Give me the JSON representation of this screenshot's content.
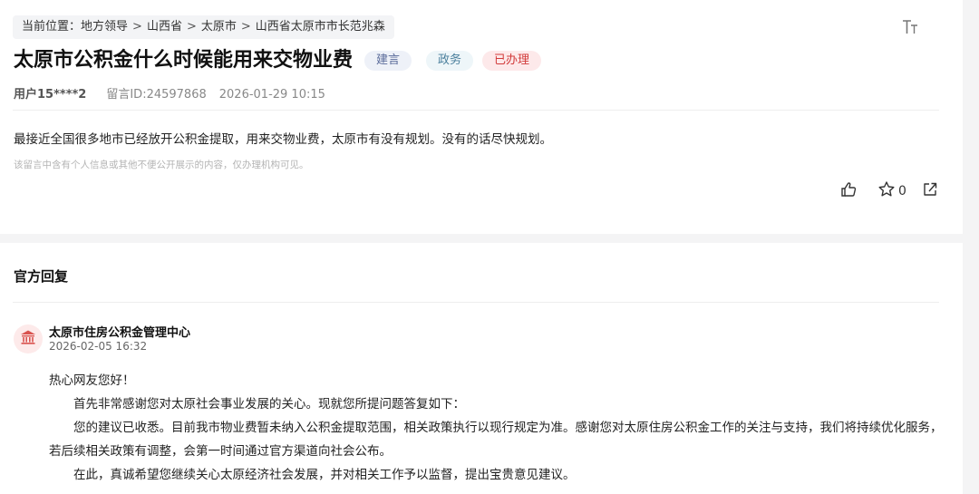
{
  "breadcrumb": {
    "prefix": "当前位置：",
    "items": [
      "地方领导",
      "山西省",
      "太原市",
      "山西省太原市市长范兆森"
    ],
    "separator": ">"
  },
  "toolbar": {
    "font_size_icon": "text-size-icon"
  },
  "message": {
    "title": "太原市公积金什么时候能用来交物业费",
    "tags": [
      {
        "label": "建言",
        "color": "#5a6b9a"
      },
      {
        "label": "政务",
        "color": "#4a7f9c"
      },
      {
        "label": "已办理",
        "color": "#d23a3a"
      }
    ],
    "user": "用户15****2",
    "message_id": "留言ID:24597868",
    "datetime": "2026-01-29 10:15",
    "content": "最接近全国很多地市已经放开公积金提取，用来交物业费，太原市有没有规划。没有的话尽快规划。",
    "privacy_note": "该留言中含有个人信息或其他不便公开展示的内容，仅办理机构可见。",
    "actions": {
      "like_icon": "thumbs-up-icon",
      "favorite_icon": "star-icon",
      "favorite_count": "0",
      "share_icon": "share-icon"
    }
  },
  "reply": {
    "section_title": "官方回复",
    "org_icon": "government-building-icon",
    "org_name": "太原市住房公积金管理中心",
    "datetime": "2026-02-05 16:32",
    "greeting": "热心网友您好！",
    "paragraphs": [
      "首先非常感谢您对太原社会事业发展的关心。现就您所提问题答复如下：",
      "您的建议已收悉。目前我市物业费暂未纳入公积金提取范围，相关政策执行以现行规定为准。感谢您对太原住房公积金工作的关注与支持，我们将持续优化服务，若后续相关政策有调整，会第一时间通过官方渠道向社会公布。",
      "在此，真诚希望您继续关心太原经济社会发展，并对相关工作予以监督，提出宝贵意见建议。"
    ]
  },
  "colors": {
    "accent_red": "#d23a3a",
    "page_bg": "#f4f4f5"
  }
}
